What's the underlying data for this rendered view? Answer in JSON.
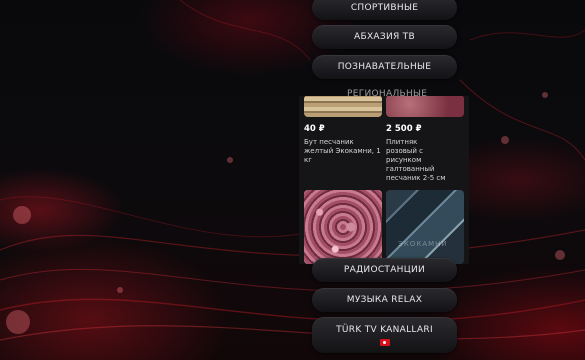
{
  "menu": {
    "sport": "Спортивные",
    "abkhazia": "Абхазия ТВ",
    "educational": "Познавательные",
    "regional_partial": "Региональные",
    "radio": "Радиостанции",
    "relax": "Музыка RELAX",
    "turk": "Türk TV Kanallari"
  },
  "ad": {
    "product1": {
      "price": "40 ₽",
      "name": "Бут песчаник желтый Экокамни, 1 кг"
    },
    "product2": {
      "price": "2 500 ₽",
      "name": "Плитняк розовый с рисунком галтованный песчаник 2-5 см"
    },
    "tile4_watermark": "ЭКОКАМНИ"
  },
  "colors": {
    "accent_red": "#d8101e",
    "button_bg": "#1e1e22"
  }
}
